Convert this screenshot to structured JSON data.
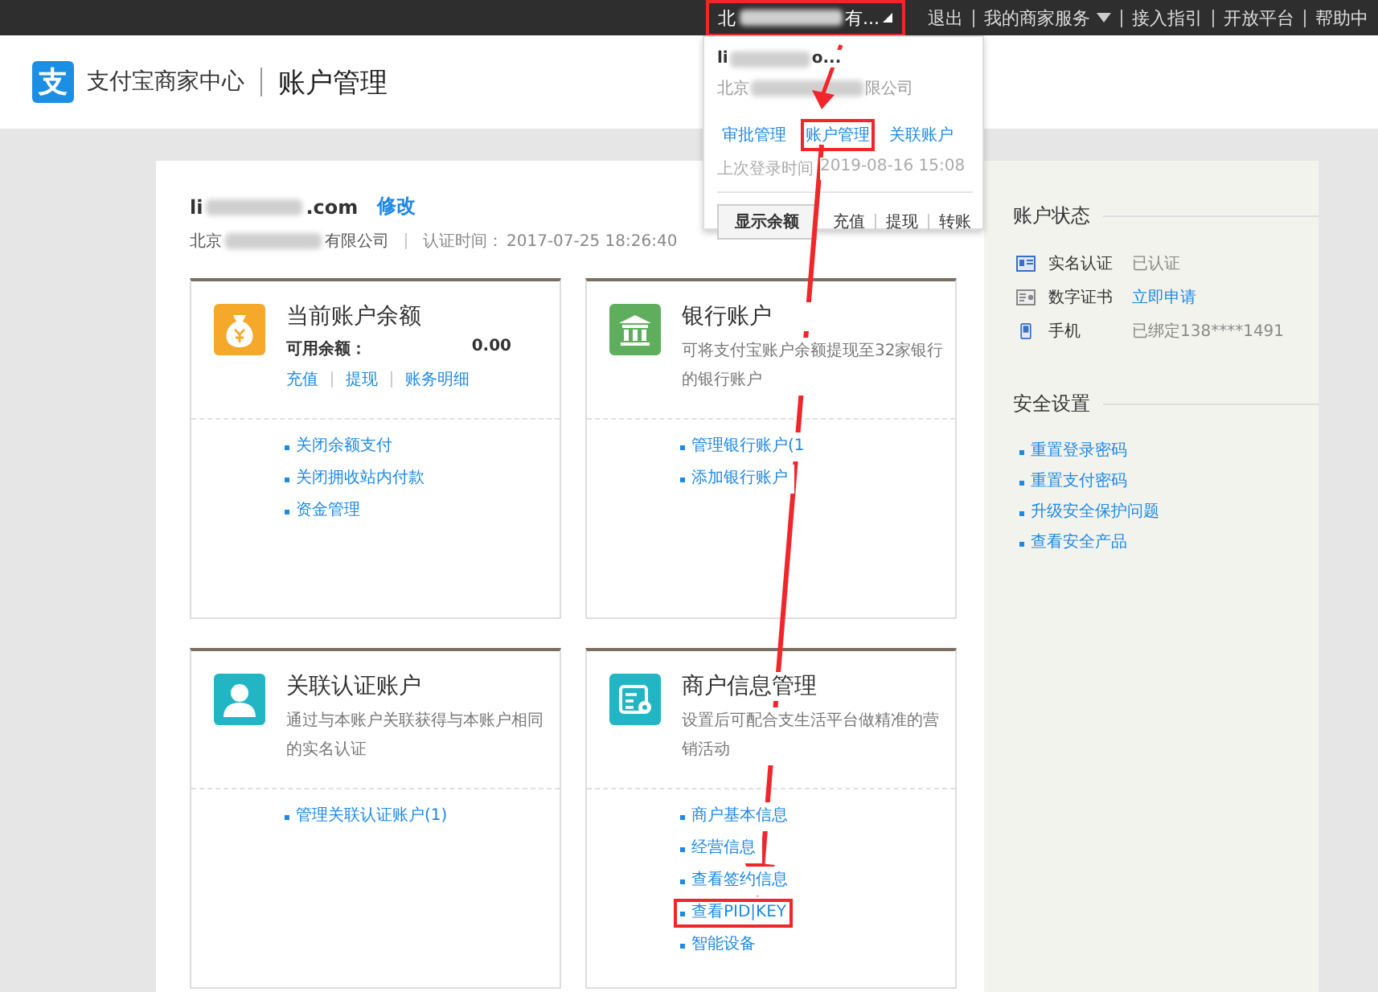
{
  "top_bar": {
    "account": {
      "prefix": "北",
      "suffix": "有...",
      "highlighted": true
    },
    "links": [
      {
        "label": "退出",
        "has_menu": false
      },
      {
        "label": "我的商家服务",
        "has_menu": true
      },
      {
        "label": "接入指引",
        "has_menu": false
      },
      {
        "label": "开放平台",
        "has_menu": false
      },
      {
        "label": "帮助中",
        "has_menu": false
      }
    ]
  },
  "header": {
    "logo_glyph": "支",
    "brand": "支付宝商家中心",
    "page_title": "账户管理"
  },
  "account": {
    "email_prefix": "li",
    "email_suffix": ".com",
    "edit_link": "修改",
    "company_prefix": "北京",
    "company_suffix": "有限公司",
    "cert_label": "认证时间：",
    "cert_time": "2017-07-25 18:26:40"
  },
  "cards": [
    {
      "title": "当前账户余额",
      "balance_label": "可用余额：",
      "balance": "0.00",
      "actions": [
        "充值",
        "提现",
        "账务明细"
      ],
      "links": [
        {
          "label": "关闭余额支付",
          "highlighted": false
        },
        {
          "label": "关闭拥收站内付款",
          "highlighted": false
        },
        {
          "label": "资金管理",
          "highlighted": false
        }
      ]
    },
    {
      "title": "银行账户",
      "description": "可将支付宝账户余额提现至32家银行的银行账户",
      "links": [
        {
          "label": "管理银行账户(1",
          "highlighted": false
        },
        {
          "label": "添加银行账户",
          "highlighted": false
        }
      ]
    },
    {
      "title": "关联认证账户",
      "description": "通过与本账户关联获得与本账户相同的实名认证",
      "links": [
        {
          "label": "管理关联认证账户(1)",
          "highlighted": false
        }
      ]
    },
    {
      "title": "商户信息管理",
      "description": "设置后可配合支生活平台做精准的营销活动",
      "links": [
        {
          "label": "商户基本信息",
          "highlighted": false
        },
        {
          "label": "经营信息",
          "highlighted": false
        },
        {
          "label": "查看签约信息",
          "highlighted": false
        },
        {
          "label": "查看PID|KEY",
          "highlighted": true
        },
        {
          "label": "智能设备",
          "highlighted": false
        }
      ]
    }
  ],
  "sidebar": {
    "status_title": "账户状态",
    "status_rows": [
      {
        "label": "实名认证",
        "value": "已认证",
        "kind": "text"
      },
      {
        "label": "数字证书",
        "value": "立即申请",
        "kind": "link"
      },
      {
        "label": "手机",
        "value": "已绑定138****1491",
        "kind": "text"
      }
    ],
    "security_title": "安全设置",
    "security_links": [
      "重置登录密码",
      "重置支付密码",
      "升级安全保护问题",
      "查看安全产品"
    ]
  },
  "dropdown": {
    "account_prefix": "li",
    "account_suffix": "o...",
    "company_prefix": "北京",
    "company_suffix": "限公司",
    "links": [
      {
        "label": "审批管理",
        "highlighted": false
      },
      {
        "label": "账户管理",
        "highlighted": true
      },
      {
        "label": "关联账户",
        "highlighted": false
      }
    ],
    "last_login_label": "上次登录时间",
    "last_login": "2019-08-16 15:08",
    "balance_button": "显示余额",
    "actions": [
      "充值",
      "提现",
      "转账"
    ]
  }
}
